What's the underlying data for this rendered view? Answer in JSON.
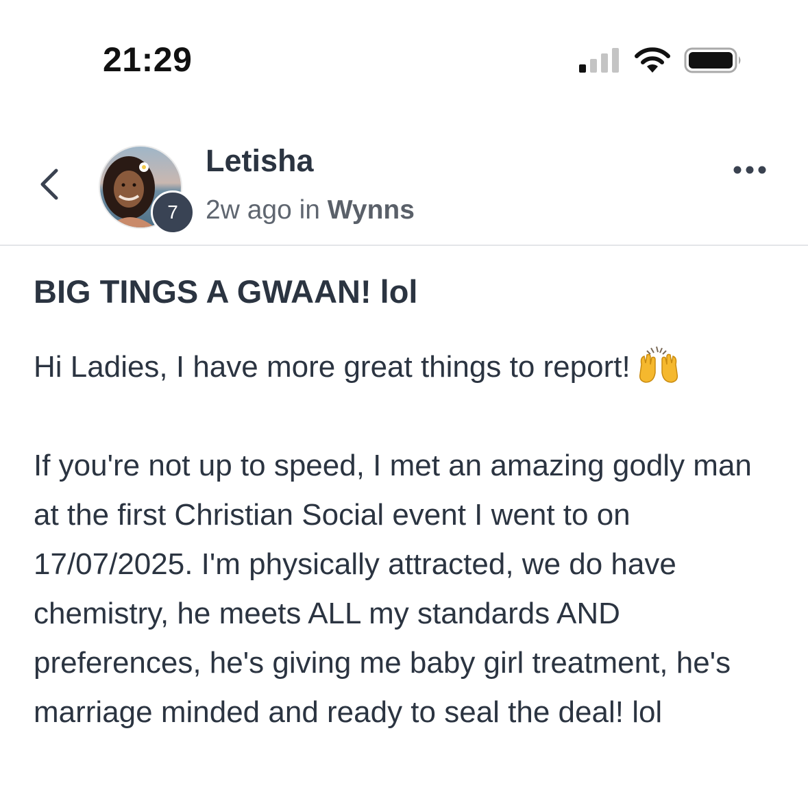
{
  "status_bar": {
    "time": "21:29"
  },
  "header": {
    "author_name": "Letisha",
    "level_badge": "7",
    "meta_time": "2w ago in ",
    "meta_group": "Wynns"
  },
  "post": {
    "title": "BIG TINGS A GWAAN! lol",
    "paragraph_1": "Hi Ladies, I have more great things to report!",
    "paragraph_1_emoji": "raising-hands-emoji",
    "paragraph_2": "If you're not up to speed, I met an amazing godly man at the first Christian Social event I went to on 17/07/2025. I'm physically attracted, we do have chemistry, he meets ALL my standards AND preferences, he's giving me baby girl treatment, he's marriage minded and ready to seal the deal! lol"
  },
  "colors": {
    "text": "#2b3441",
    "meta": "#5f6670",
    "badge": "#394354",
    "divider": "#e3e5e8",
    "emoji": "#f5b82e"
  }
}
